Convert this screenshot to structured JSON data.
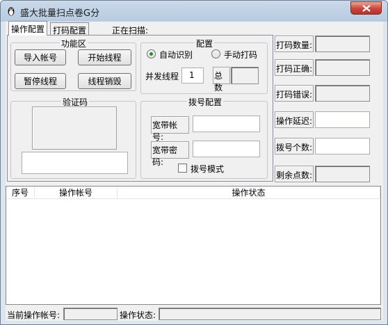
{
  "window": {
    "title": "盛大批量扫点卷G分",
    "close_glyph": "×",
    "app_icon": "penguin-icon"
  },
  "tabs": [
    {
      "label": "操作配置",
      "active": true
    },
    {
      "label": "打码配置",
      "active": false
    }
  ],
  "scan_status_label": "正在扫描:",
  "function_group": {
    "title": "功能区",
    "buttons": {
      "import_accounts": "导入帐号",
      "start_threads": "开始线程",
      "pause_threads": "暂停线程",
      "destroy_threads": "线程销毁"
    }
  },
  "config_group": {
    "title": "配置",
    "auto_recognize": "自动识别",
    "manual_captcha": "手动打码",
    "concurrency_label": "并发线程",
    "concurrency_value": "1",
    "total_label": "总数",
    "total_value": ""
  },
  "captcha_group": {
    "title": "验证码",
    "input_value": ""
  },
  "dial_group": {
    "title": "拨号配置",
    "account_label": "宽带帐号:",
    "account_value": "",
    "password_label": "宽带密码:",
    "password_value": "",
    "dial_mode_label": "拨号模式",
    "dial_mode_checked": false
  },
  "stats": [
    {
      "label": "打码数量:",
      "value": ""
    },
    {
      "label": "打码正确:",
      "value": ""
    },
    {
      "label": "打码错误:",
      "value": ""
    },
    {
      "label": "操作延迟:",
      "value": ""
    },
    {
      "label": "拨号个数:",
      "value": ""
    },
    {
      "label": "剩余点数:",
      "value": ""
    }
  ],
  "table": {
    "columns": [
      "序号",
      "操作帐号",
      "操作状态"
    ],
    "rows": []
  },
  "status_bar": {
    "current_account_label": "当前操作帐号:",
    "current_account_value": "",
    "op_status_label": "操作状态:",
    "op_status_value": ""
  }
}
